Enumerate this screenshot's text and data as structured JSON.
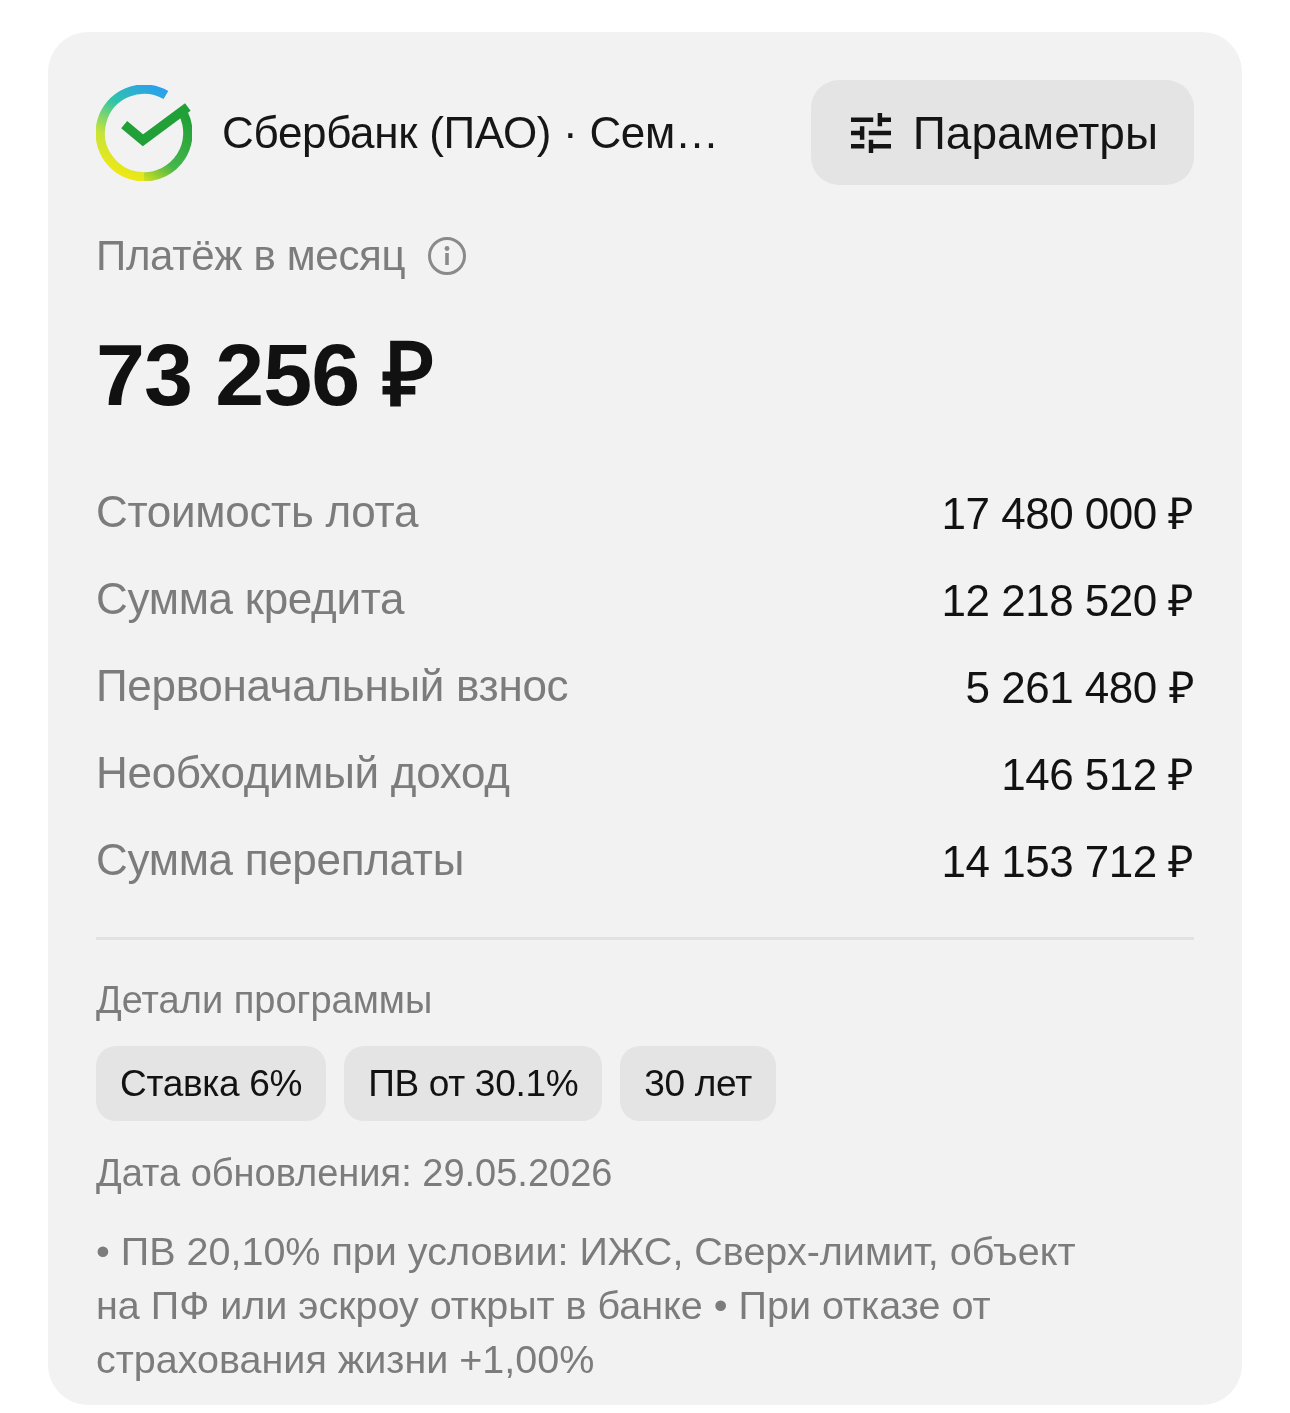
{
  "header": {
    "bank_name": "Сбербанк (ПАО) · Сем…",
    "params_button": "Параметры"
  },
  "payment": {
    "label": "Платёж в месяц",
    "amount": "73 256 ₽"
  },
  "summary": [
    {
      "label": "Стоимость лота",
      "value": "17 480 000 ₽"
    },
    {
      "label": "Сумма кредита",
      "value": "12 218 520 ₽"
    },
    {
      "label": "Первоначальный взнос",
      "value": "5 261 480 ₽"
    },
    {
      "label": "Необходимый доход",
      "value": "146 512 ₽"
    },
    {
      "label": "Сумма переплаты",
      "value": "14 153 712 ₽"
    }
  ],
  "program": {
    "title": "Детали программы",
    "tags": [
      "Ставка 6%",
      "ПВ от 30.1%",
      "30 лет"
    ],
    "updated": "Дата обновления: 29.05.2026",
    "notes": "• ПВ 20,10% при условии: ИЖС, Сверх-лимит, объект на ПФ или эскроу открыт в банке • При отказе от страхования жизни +1,00%"
  }
}
